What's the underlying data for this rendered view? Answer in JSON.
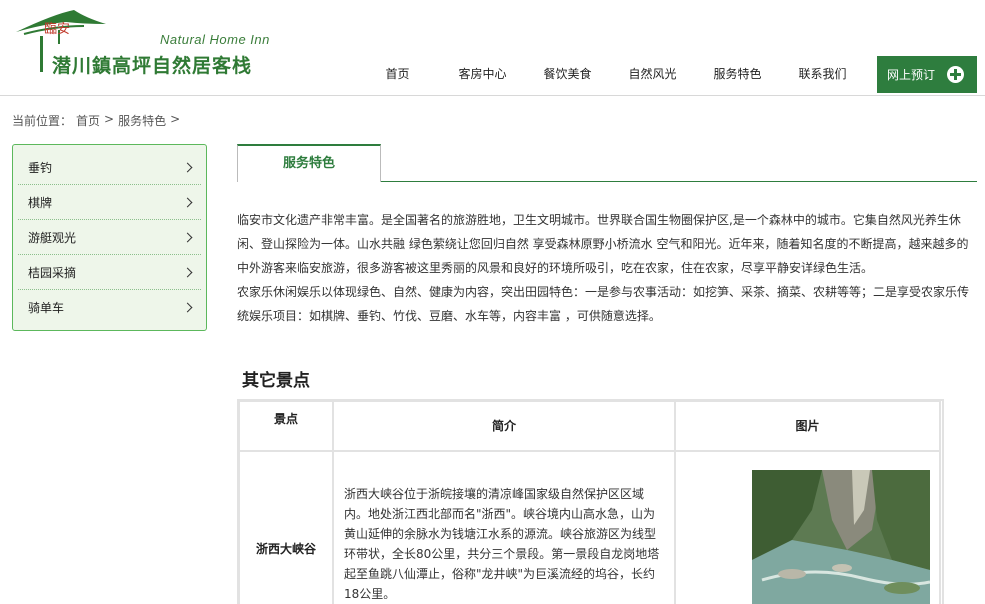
{
  "brand": {
    "seal": "臨安",
    "name_en": "Natural Home Inn",
    "name_cn": "潜川鎮高坪自然居客栈"
  },
  "nav": {
    "items": [
      "首页",
      "客房中心",
      "餐饮美食",
      "自然风光",
      "服务特色",
      "联系我们"
    ],
    "book_label": "网上预订"
  },
  "breadcrumb": {
    "prefix": "当前位置：",
    "home": "首页",
    "sep": ">",
    "current": "服务特色"
  },
  "sidebar": {
    "items": [
      "垂钓",
      "棋牌",
      "游艇观光",
      "桔园采摘",
      "骑单车"
    ]
  },
  "main": {
    "tab_label": "服务特色",
    "intro_p1": "临安市文化遗产非常丰富。是全国著名的旅游胜地，卫生文明城市。世界联合国生物圈保护区,是一个森林中的城市。它集自然风光养生休闲、登山探险为一体。山水共融 绿色萦绕让您回归自然 享受森林原野小桥流水 空气和阳光。近年来，随着知名度的不断提高，越来越多的中外游客来临安旅游，很多游客被这里秀丽的风景和良好的环境所吸引，吃在农家，住在农家，尽享平静安详绿色生活。",
    "intro_p2": "农家乐休闲娱乐以体现绿色、自然、健康为内容，突出田园特色：一是参与农事活动：如挖笋、采茶、摘菜、农耕等等；二是享受农家乐传统娱乐项目：如棋牌、垂钓、竹伐、豆磨、水车等，内容丰富 ，可供随意选择。",
    "section_title": "其它景点",
    "table": {
      "headers": [
        "景点",
        "简介",
        "图片"
      ],
      "rows": [
        {
          "name": "浙西大峡谷",
          "desc": "浙西大峡谷位于浙皖接壤的清凉峰国家级自然保护区区域内。地处浙江西北部而名\"浙西\"。峡谷境内山高水急，山为黄山延伸的余脉水为钱塘江水系的源流。峡谷旅游区为线型环带状，全长80公里，共分三个景段。第一景段自龙岗地塔起至鱼跳八仙潭止，俗称\"龙井峡\"为巨溪流经的坞谷，长约18公里。"
        }
      ]
    }
  }
}
